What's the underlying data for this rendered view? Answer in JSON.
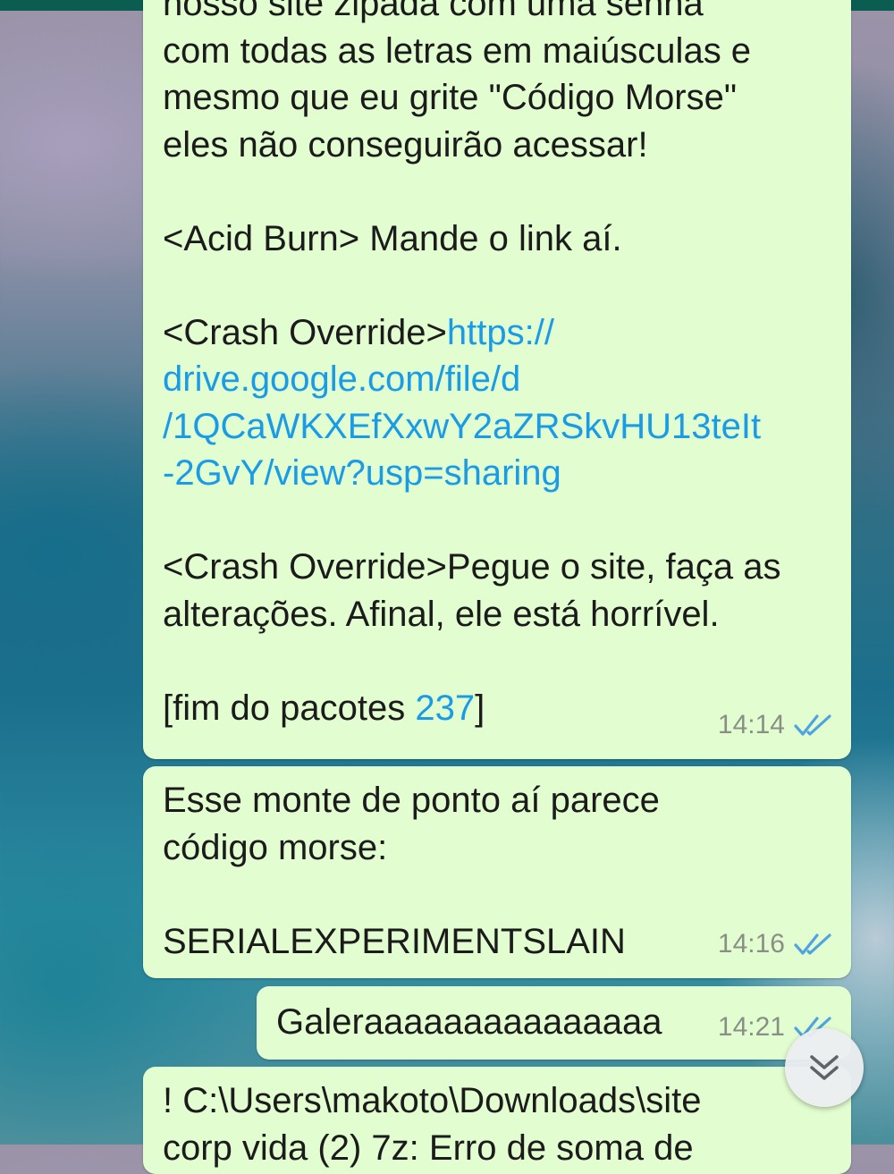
{
  "messages": [
    {
      "lines": [
        "nosso site zipada com uma senha",
        "com todas as letras em maiúsculas e",
        "mesmo que eu grite \"Código Morse\"",
        "eles não conseguirão acessar!",
        "",
        "<Acid Burn> Mande o link aí.",
        "",
        "<Crash Override>",
        "drive.google.com/file/d",
        "/1QCaWKXEfXxwY2aZRSkvHU13teIt",
        "-2GvY/view?usp=sharing",
        "",
        "<Crash Override>Pegue o site, faça as",
        "alterações. Afinal, ele está horrível.",
        "",
        "[fim do pacotes "
      ],
      "link_start": "https://",
      "number": "237",
      "bracket_close": "]",
      "time": "14:14"
    },
    {
      "lines": [
        "Esse monte de ponto aí parece",
        "código morse:",
        "",
        "SERIALEXPERIMENTSLAIN"
      ],
      "time": "14:16"
    },
    {
      "text": "Galeraaaaaaaaaaaaaaa",
      "time": "14:21"
    },
    {
      "lines": [
        "! C:\\Users\\makoto\\Downloads\\site",
        "corp vida (2) 7z: Erro de soma de"
      ]
    }
  ],
  "colors": {
    "bubble": "#e2fdcf",
    "link": "#1a9be6",
    "ticks": "#4fa3e0",
    "header": "#0b5d52"
  },
  "scroll_button": {
    "icon": "double-chevron-down-icon"
  }
}
